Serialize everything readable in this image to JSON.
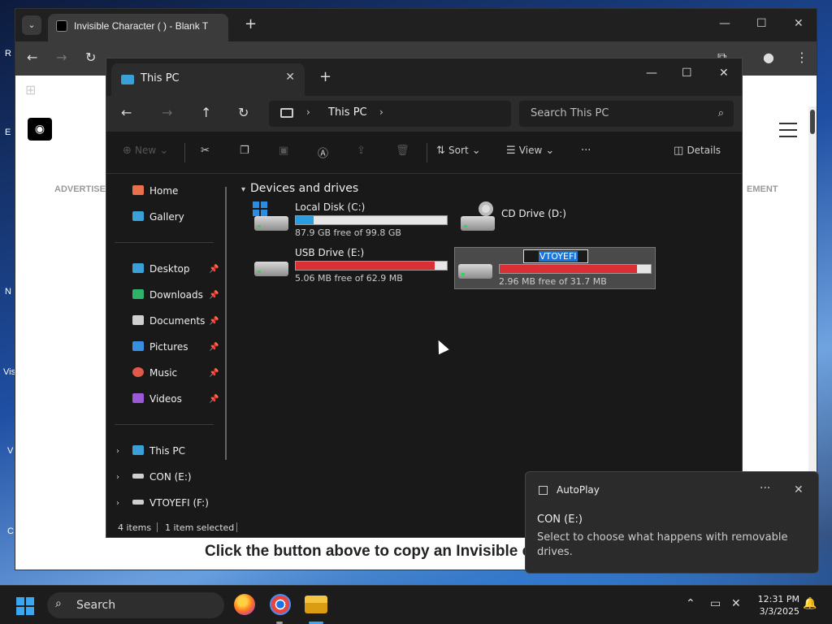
{
  "desktop": {
    "icon_labels": [
      "R",
      "E",
      "N",
      "Vis",
      "V",
      "C"
    ]
  },
  "browser": {
    "tab_title": "Invisible Character (   ) - Blank T",
    "tab_close": "✕",
    "new_tab": "+",
    "dropdown_icon": "⌄",
    "url_partial": "",
    "page": {
      "advertise_left": "ADVERTISE",
      "advertise_right": "EMENT",
      "body_text": "Click the button above to copy an Invisible c"
    }
  },
  "explorer": {
    "tab_label": "This PC",
    "address": {
      "crumb": "This PC"
    },
    "search_placeholder": "Search This PC",
    "commands": {
      "new": "New",
      "sort": "Sort",
      "view": "View",
      "more": "···",
      "details": "Details"
    },
    "sidebar": {
      "quick": [
        {
          "label": "Home",
          "color": "#e8704a"
        },
        {
          "label": "Gallery",
          "color": "#3aa0d8"
        }
      ],
      "pinned": [
        {
          "label": "Desktop",
          "color": "#3aa0d8"
        },
        {
          "label": "Downloads",
          "color": "#2fb36a"
        },
        {
          "label": "Documents",
          "color": "#cfcfcf"
        },
        {
          "label": "Pictures",
          "color": "#3a8ee0"
        },
        {
          "label": "Music",
          "color": "#e05a4a"
        },
        {
          "label": "Videos",
          "color": "#9a5ad8"
        }
      ],
      "tree": [
        {
          "label": "This PC",
          "color": "#3aa0d8"
        },
        {
          "label": "CON (E:)",
          "color": "#cfcfcf"
        },
        {
          "label": "VTOYEFI (F:)",
          "color": "#cfcfcf"
        }
      ]
    },
    "section_title": "Devices and drives",
    "drives": [
      {
        "name": "Local Disk (C:)",
        "free": "87.9 GB free of 99.8 GB",
        "used_fraction": 0.12,
        "bar_color": "#2a9de0",
        "icon": "windows-drive-icon"
      },
      {
        "name": "CD Drive (D:)",
        "free": "",
        "used_fraction": null,
        "bar_color": "",
        "icon": "cd-drive-icon"
      },
      {
        "name": "USB Drive (E:)",
        "free": "5.06 MB free of 62.9 MB",
        "used_fraction": 0.92,
        "bar_color": "#da2f35",
        "icon": "usb-drive-icon"
      },
      {
        "name": "VTOYEFI",
        "free": "2.96 MB free of 31.7 MB",
        "used_fraction": 0.91,
        "bar_color": "#da2f35",
        "icon": "usb-drive-icon"
      }
    ],
    "status": {
      "items": "4 items",
      "selected": "1 item selected"
    }
  },
  "autoplay": {
    "app_name": "AutoPlay",
    "more": "···",
    "close": "✕",
    "title": "CON (E:)",
    "body": "Select to choose what happens with removable drives."
  },
  "taskbar": {
    "search_label": "Search",
    "time": "12:31 PM",
    "date": "3/3/2025"
  }
}
